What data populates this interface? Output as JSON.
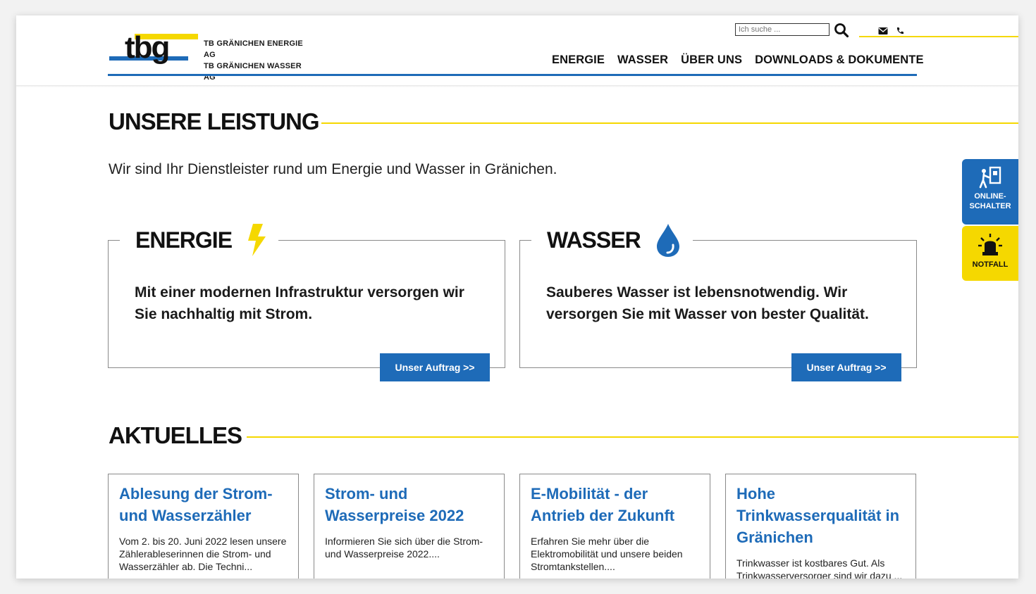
{
  "brand": {
    "logo_word": "tbg",
    "company_line1": "TB GRÄNICHEN ENERGIE AG",
    "company_line2": "TB GRÄNICHEN WASSER AG"
  },
  "search": {
    "placeholder": "Ich suche ..."
  },
  "nav": {
    "items": [
      "ENERGIE",
      "WASSER",
      "ÜBER UNS",
      "DOWNLOADS & DOKUMENTE"
    ]
  },
  "leistung": {
    "title": "UNSERE LEISTUNG",
    "lead": "Wir sind Ihr Dienstleister rund um Energie und Wasser in Gränichen."
  },
  "services": [
    {
      "title": "ENERGIE",
      "icon": "lightning-icon",
      "text": "Mit einer modernen Infrastruktur versorgen wir Sie nachhaltig mit Strom.",
      "button": "Unser Auftrag >>"
    },
    {
      "title": "WASSER",
      "icon": "water-drop-icon",
      "text": "Sauberes Wasser ist lebensnotwendig. Wir versorgen Sie mit Wasser von bester Qualität.",
      "button": "Unser Auftrag >>"
    }
  ],
  "aktuelles": {
    "title": "AKTUELLES",
    "items": [
      {
        "title": "Ablesung der Strom- und Wasserzähler",
        "text": "Vom 2. bis 20. Juni 2022 lesen unsere Zählerableserinnen die Strom- und Wasserzähler ab. Die Techni..."
      },
      {
        "title": "Strom- und Wasserpreise 2022",
        "text": "Informieren Sie sich über die Strom- und Wasserpreise 2022...."
      },
      {
        "title": "E-Mobilität - der Antrieb der Zukunft",
        "text": "Erfahren Sie mehr über die Elektromobilität und unsere beiden Stromtankstellen...."
      },
      {
        "title": "Hohe Trinkwasserqualität in Gränichen",
        "text": "Trinkwasser ist kostbares Gut. Als Trinkwasserversorger sind wir dazu ..."
      }
    ]
  },
  "side_tabs": {
    "online": {
      "line1": "ONLINE-",
      "line2": "SCHALTER",
      "color": "#1e6bb8"
    },
    "notfall": {
      "line1": "NOTFALL",
      "color": "#f5d800"
    }
  },
  "colors": {
    "blue": "#1e6bb8",
    "yellow": "#f5d800"
  }
}
